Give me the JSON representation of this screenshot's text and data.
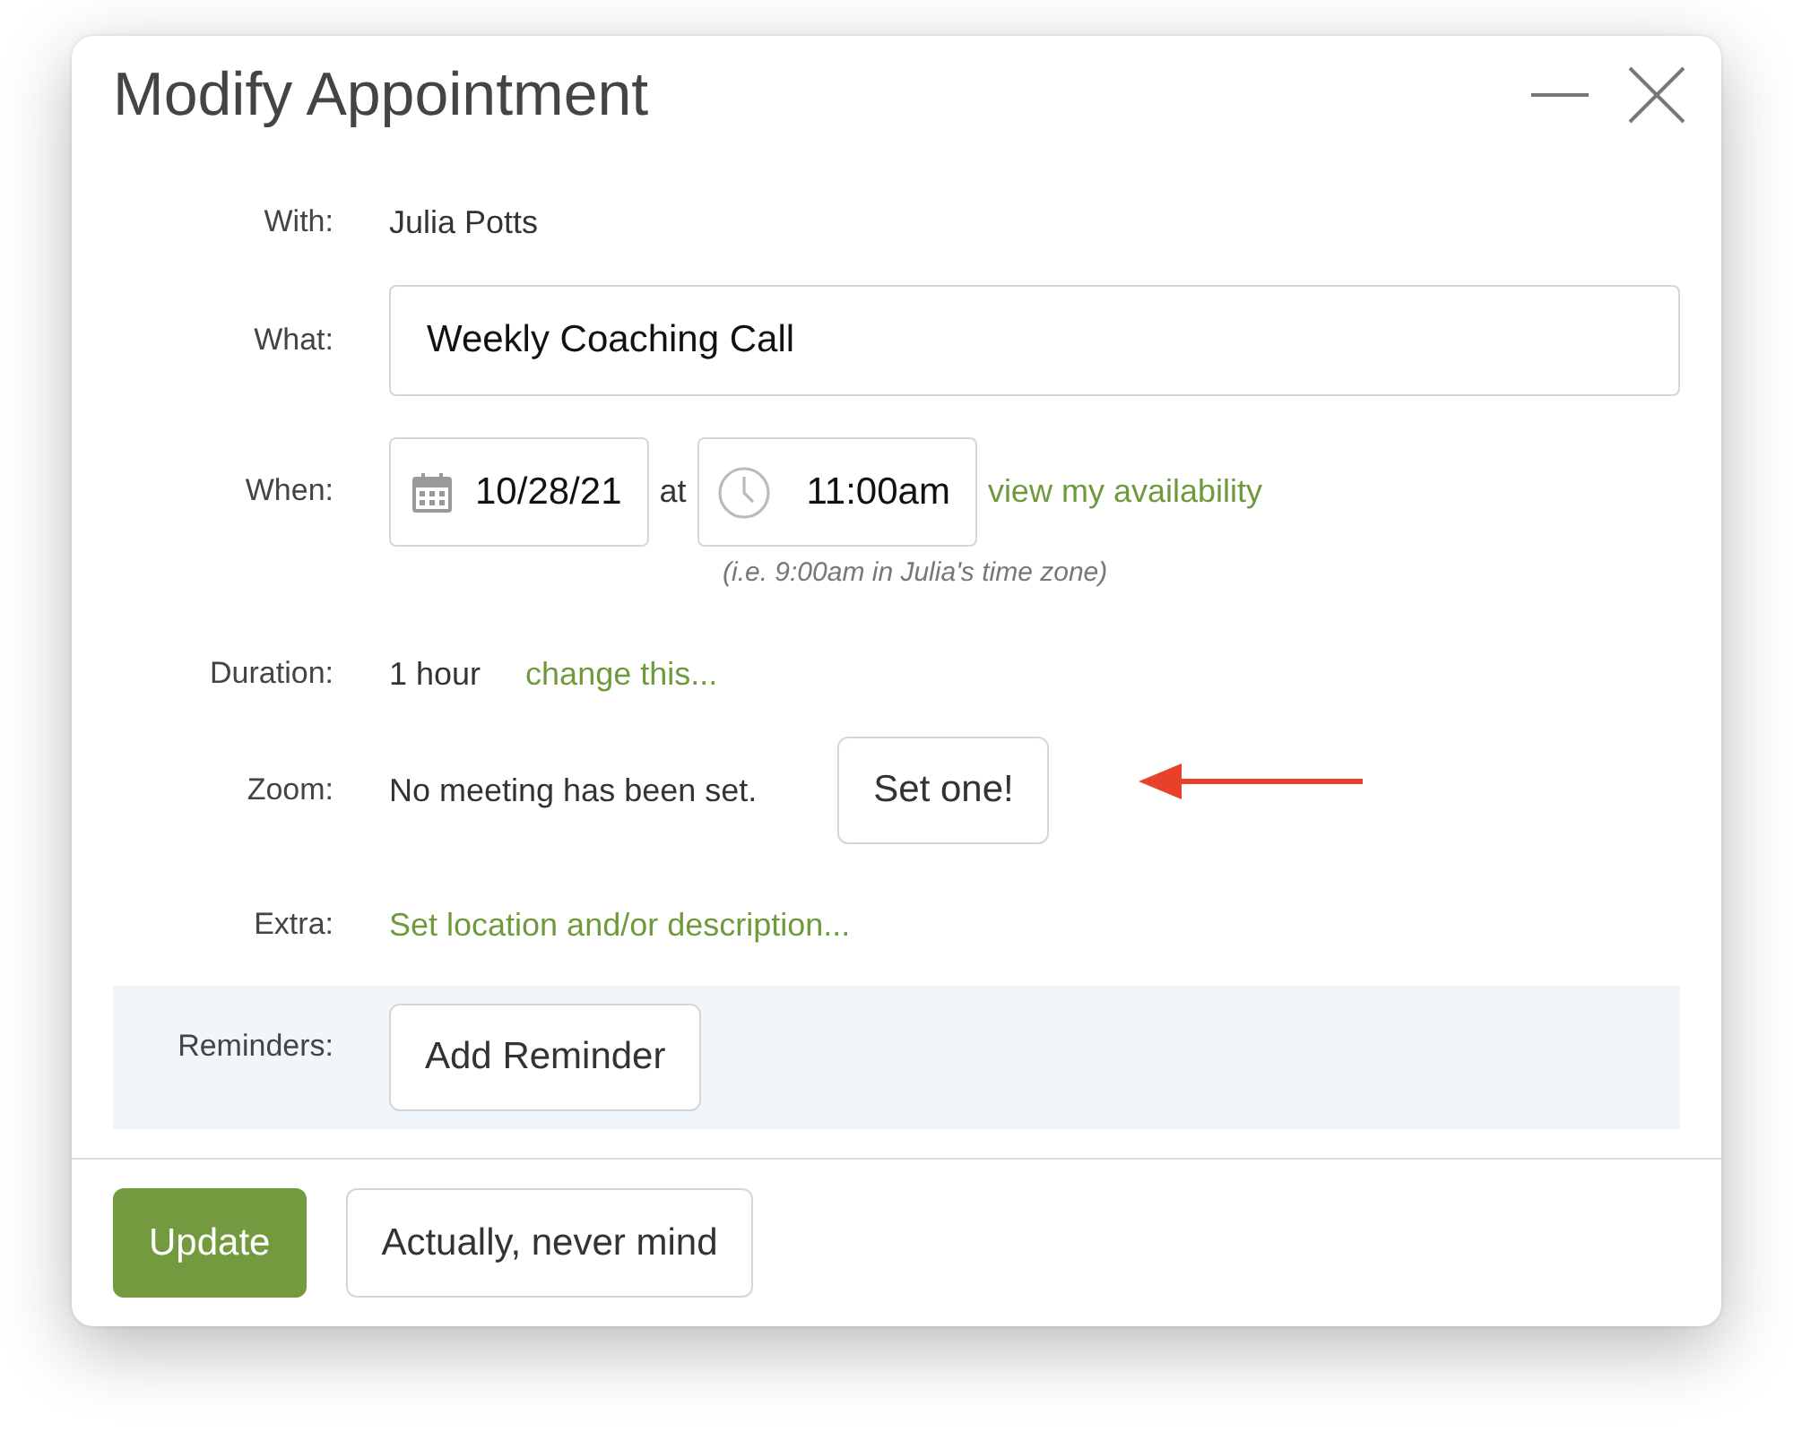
{
  "window": {
    "title": "Modify Appointment"
  },
  "fields": [
    {
      "kind": "text",
      "label": "With:",
      "value": "Julia Potts"
    },
    {
      "kind": "input",
      "label": "What:",
      "value": "Weekly Coaching Call"
    },
    {
      "kind": "datetime",
      "label": "When:",
      "date": "10/28/21",
      "connector": "at",
      "time": "11:00am",
      "link": "view my availability",
      "hint": "(i.e. 9:00am in Julia's time zone)"
    },
    {
      "kind": "text_link",
      "label": "Duration:",
      "value": "1 hour",
      "link": "change this..."
    },
    {
      "kind": "text_button",
      "label": "Zoom:",
      "value": "No meeting has been set.",
      "button": "Set one!"
    },
    {
      "kind": "link",
      "label": "Extra:",
      "link": "Set location and/or description..."
    },
    {
      "kind": "button",
      "label": "Reminders:",
      "button": "Add Reminder",
      "highlighted": true
    }
  ],
  "buttons": [
    {
      "label": "Update",
      "primary": true
    },
    {
      "label": "Actually, never mind",
      "primary": false
    }
  ]
}
